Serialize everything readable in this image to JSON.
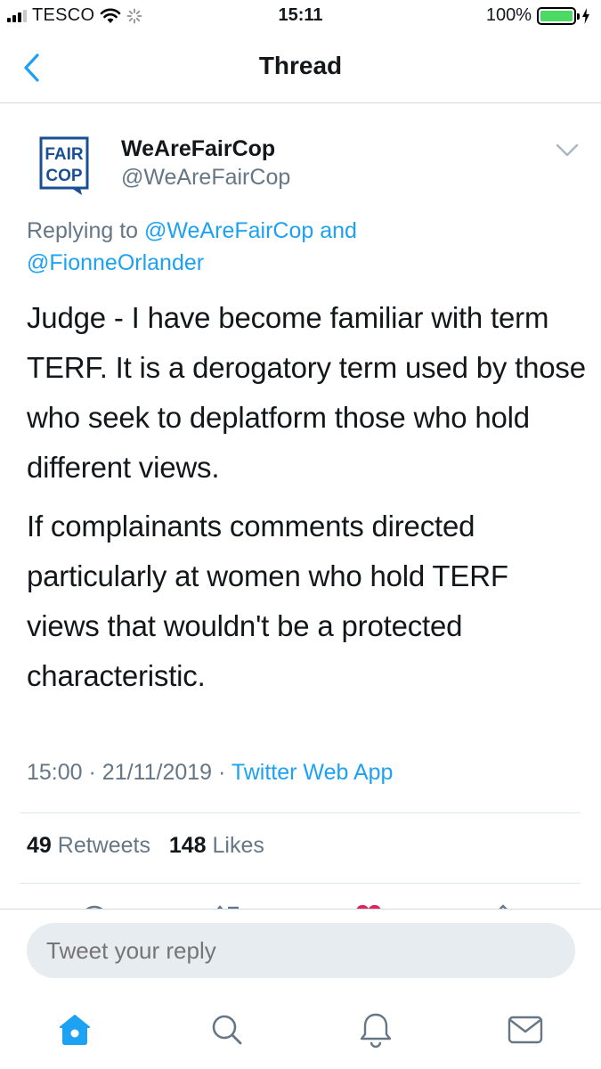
{
  "status_bar": {
    "carrier": "TESCO",
    "time": "15:11",
    "battery": "100%"
  },
  "nav": {
    "title": "Thread",
    "back_icon": "chevron-left-icon"
  },
  "tweet": {
    "avatar_line1": "FAIR",
    "avatar_line2": "COP",
    "author_name": "WeAreFairCop",
    "author_handle": "@WeAreFairCop",
    "replying_prefix": "Replying to",
    "replying_handle1": "@WeAreFairCop",
    "replying_and": "and",
    "replying_handle2": "@FionneOrlander",
    "body_paragraph1": "Judge - I have become familiar with term TERF. It is a derogatory term used by those who seek to deplatform those who hold different views.",
    "body_paragraph2": "If complainants comments directed particularly at women who hold TERF views that wouldn't be a protected characteristic.",
    "time": "15:00",
    "date": "21/11/2019",
    "source": "Twitter Web App",
    "retweets_count": "49",
    "retweets_label": "Retweets",
    "likes_count": "148",
    "likes_label": "Likes"
  },
  "composer": {
    "placeholder": "Tweet your reply"
  },
  "tab_bar": {
    "items": [
      "home-icon",
      "search-icon",
      "notifications-icon",
      "messages-icon"
    ],
    "active_color": "#1da1f2"
  },
  "colors": {
    "accent": "#1da1f2",
    "secondary_text": "#657786",
    "like": "#e0245e"
  }
}
